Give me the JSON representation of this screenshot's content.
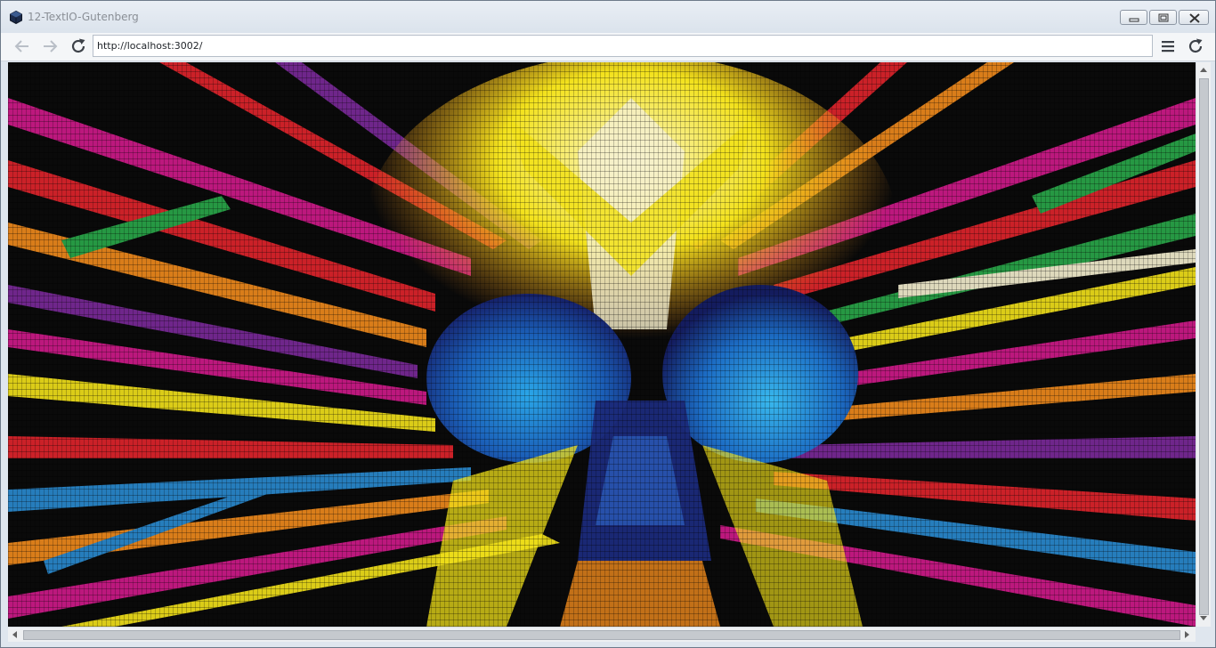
{
  "window": {
    "title": "12-TextIO-Gutenberg",
    "app_icon": "cube-icon",
    "controls": {
      "minimize": "minimize-icon",
      "maximize": "restore-icon",
      "close": "close-icon"
    }
  },
  "navbar": {
    "back_icon": "arrow-left-icon",
    "forward_icon": "arrow-right-icon",
    "reload_icon": "reload-icon",
    "url": "http://localhost:3002/",
    "menu_icon": "hamburger-menu-icon",
    "reload_right_icon": "reload-icon"
  },
  "content": {
    "description_kind": "canvas",
    "palette": {
      "background": "#000000",
      "blue_dark": "#1b2a7a",
      "blue_light": "#1e90d8",
      "yellow": "#f2e21a",
      "orange": "#f08a1c",
      "red": "#e0242c",
      "magenta": "#d01a8a",
      "purple": "#7a2a9a",
      "green": "#2aa84a",
      "cream": "#f5f0d0"
    }
  },
  "colors": {
    "titlebar": "#dbe3ec",
    "title_text": "#8a8f96",
    "navbar": "#f4f6f8",
    "scrollbar_track": "#eef0f2",
    "scrollbar_thumb": "#c5c9ce"
  }
}
